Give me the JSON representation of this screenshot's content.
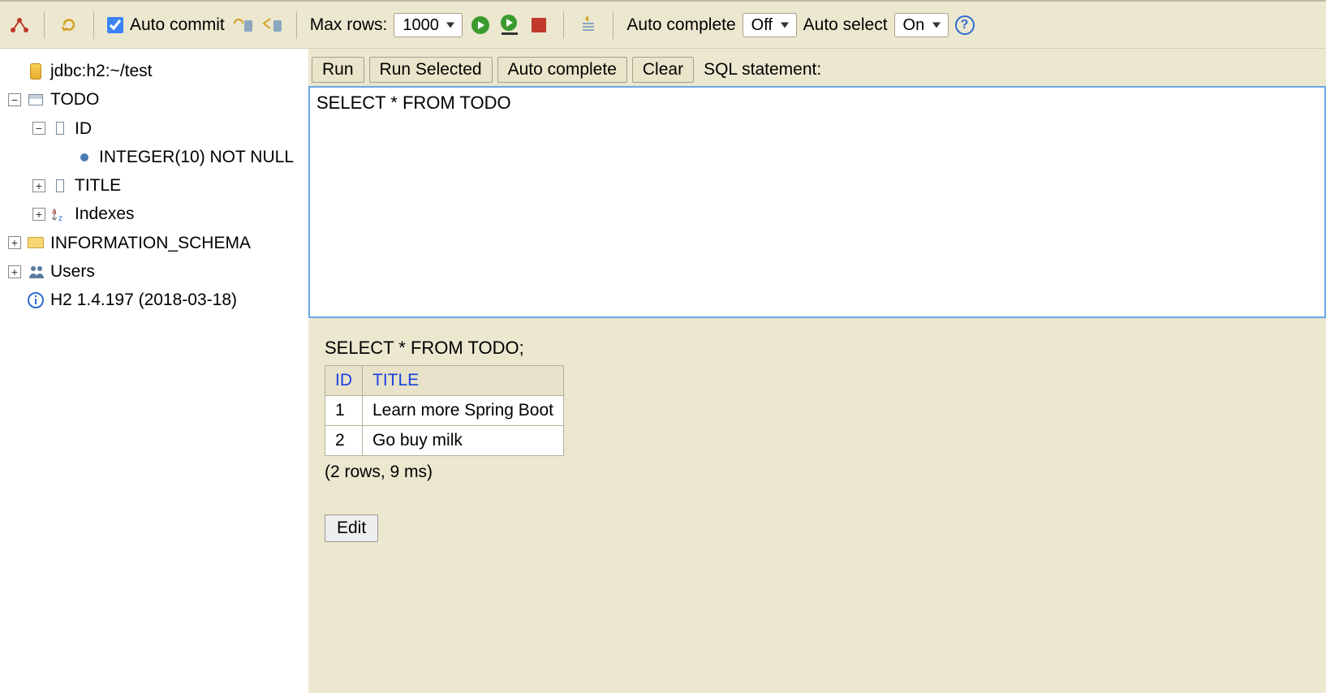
{
  "toolbar": {
    "auto_commit_label": "Auto commit",
    "auto_commit_checked": true,
    "max_rows_label": "Max rows:",
    "max_rows_value": "1000",
    "auto_complete_label": "Auto complete",
    "auto_complete_value": "Off",
    "auto_select_label": "Auto select",
    "auto_select_value": "On"
  },
  "tree": {
    "connection": "jdbc:h2:~/test",
    "table": "TODO",
    "col_id": "ID",
    "col_id_type": "INTEGER(10) NOT NULL",
    "col_title": "TITLE",
    "indexes": "Indexes",
    "info_schema": "INFORMATION_SCHEMA",
    "users": "Users",
    "version": "H2 1.4.197 (2018-03-18)"
  },
  "sql": {
    "run": "Run",
    "run_selected": "Run Selected",
    "auto_complete": "Auto complete",
    "clear": "Clear",
    "statement_label": "SQL statement:",
    "editor_value": "SELECT * FROM TODO"
  },
  "result": {
    "query": "SELECT * FROM TODO;",
    "columns": [
      "ID",
      "TITLE"
    ],
    "rows": [
      {
        "id": "1",
        "title": "Learn more Spring Boot"
      },
      {
        "id": "2",
        "title": "Go buy milk"
      }
    ],
    "summary": "(2 rows, 9 ms)",
    "edit": "Edit"
  }
}
